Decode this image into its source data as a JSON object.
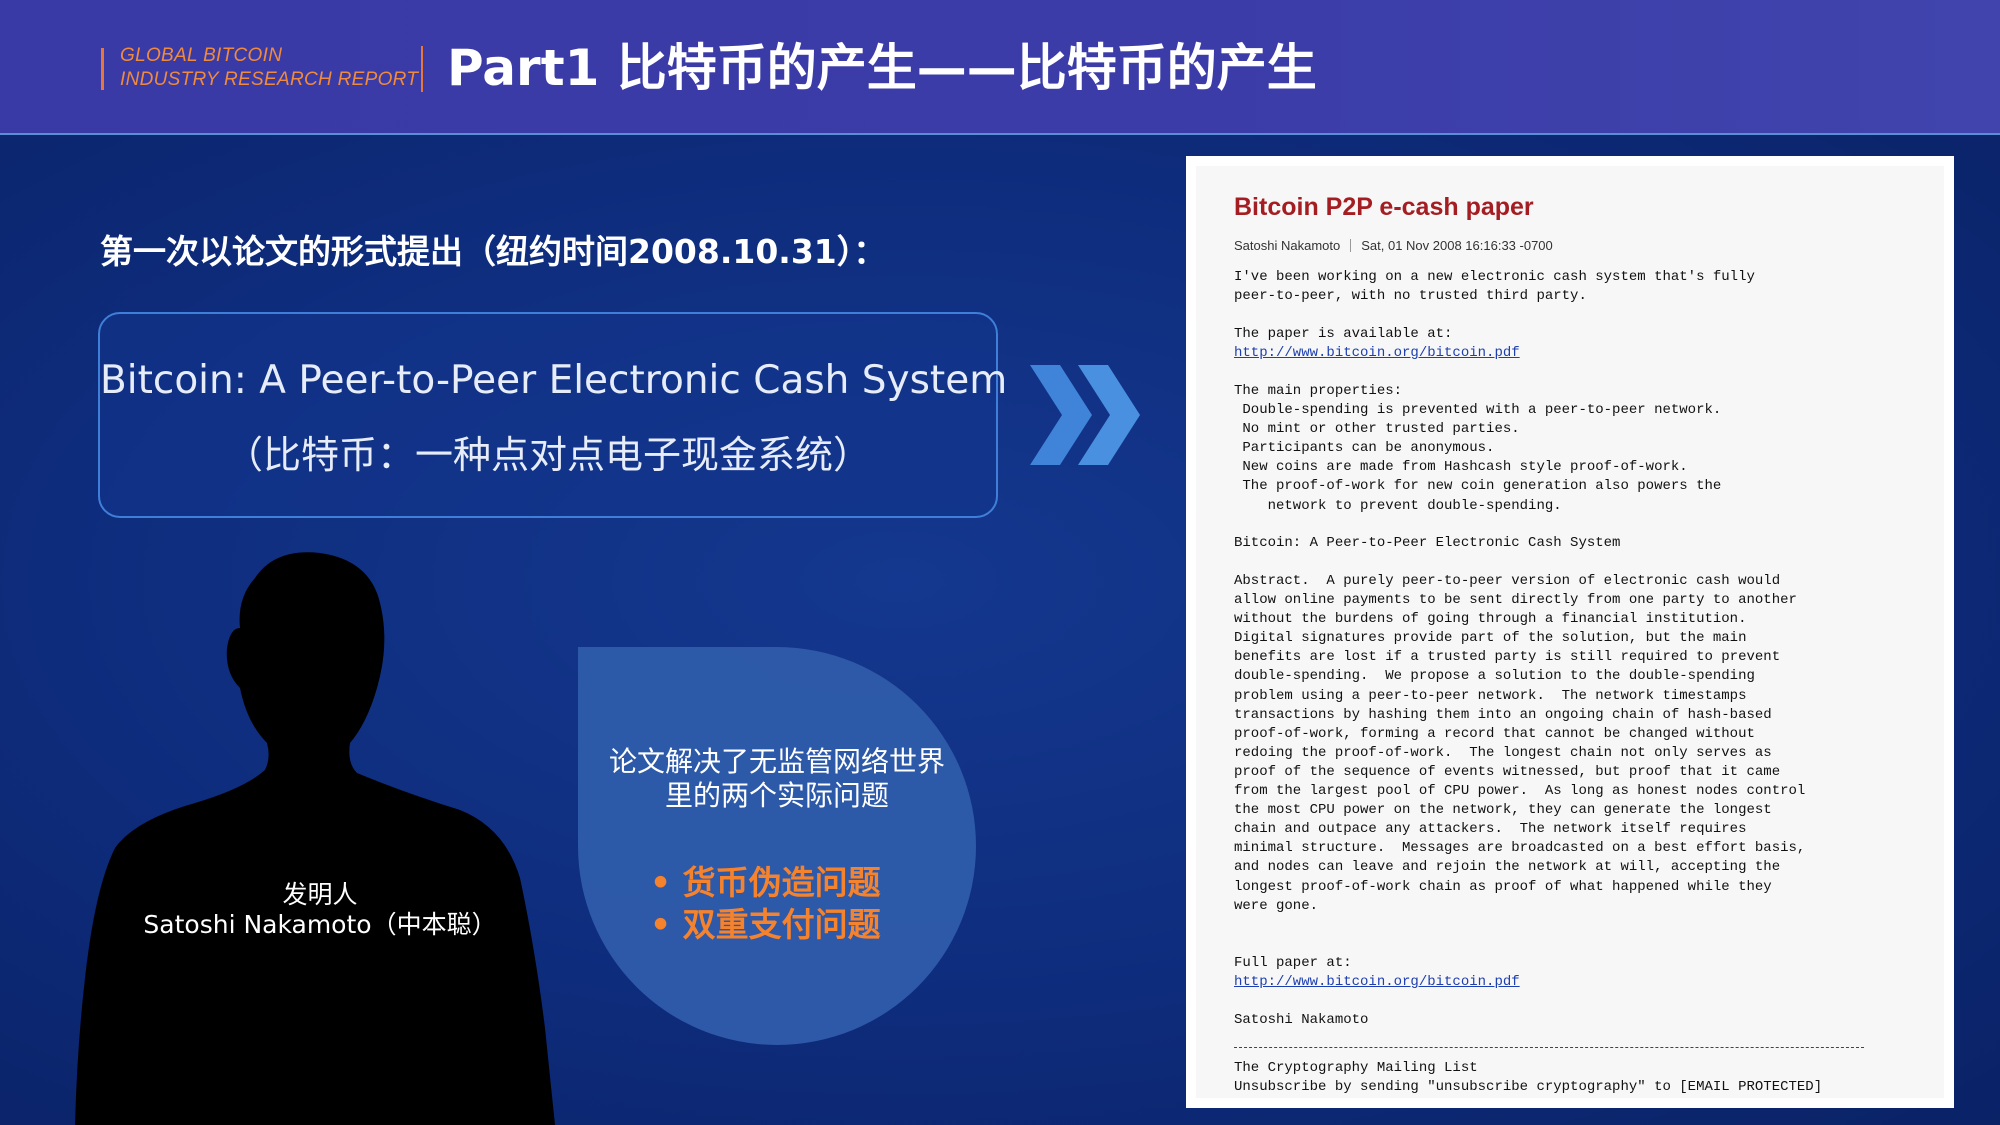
{
  "header": {
    "brand_line1": "GLOBAL BITCOIN",
    "brand_line2": "INDUSTRY RESEARCH REPORT",
    "title": "Part1 比特币的产生——比特币的产生"
  },
  "intro": {
    "subtitle": "第一次以论文的形式提出（纽约时间2008.10.31）：",
    "paper_title_en": "Bitcoin: A Peer-to-Peer Electronic Cash System",
    "paper_title_cn": "（比特币：一种点对点电子现金系统）"
  },
  "inventor": {
    "role": "发明人",
    "name": "Satoshi Nakamoto（中本聪）"
  },
  "bubble": {
    "text_line1": "论文解决了无监管网络世界",
    "text_line2": "里的两个实际问题",
    "items": [
      "货币伪造问题",
      "双重支付问题"
    ]
  },
  "document": {
    "title": "Bitcoin P2P e-cash paper",
    "author": "Satoshi Nakamoto",
    "date": "Sat, 01 Nov 2008 16:16:33 -0700",
    "intro": "I've been working on a new electronic cash system that's fully\npeer-to-peer, with no trusted third party.",
    "available_label": "The paper is available at:",
    "link": "http://www.bitcoin.org/bitcoin.pdf",
    "properties": "The main properties:\n Double-spending is prevented with a peer-to-peer network.\n No mint or other trusted parties.\n Participants can be anonymous.\n New coins are made from Hashcash style proof-of-work.\n The proof-of-work for new coin generation also powers the\n    network to prevent double-spending.",
    "paper_name": "Bitcoin: A Peer-to-Peer Electronic Cash System",
    "abstract": "Abstract.  A purely peer-to-peer version of electronic cash would\nallow online payments to be sent directly from one party to another\nwithout the burdens of going through a financial institution.\nDigital signatures provide part of the solution, but the main\nbenefits are lost if a trusted party is still required to prevent\ndouble-spending.  We propose a solution to the double-spending\nproblem using a peer-to-peer network.  The network timestamps\ntransactions by hashing them into an ongoing chain of hash-based\nproof-of-work, forming a record that cannot be changed without\nredoing the proof-of-work.  The longest chain not only serves as\nproof of the sequence of events witnessed, but proof that it came\nfrom the largest pool of CPU power.  As long as honest nodes control\nthe most CPU power on the network, they can generate the longest\nchain and outpace any attackers.  The network itself requires\nminimal structure.  Messages are broadcasted on a best effort basis,\nand nodes can leave and rejoin the network at will, accepting the\nlongest proof-of-work chain as proof of what happened while they\nwere gone.",
    "full_paper_label": "Full paper at:",
    "full_paper_link": "http://www.bitcoin.org/bitcoin.pdf",
    "signature": "Satoshi Nakamoto",
    "footer": "The Cryptography Mailing List\nUnsubscribe by sending \"unsubscribe cryptography\" to [EMAIL PROTECTED]"
  },
  "colors": {
    "background": "#0d2a78",
    "header": "#3a3aa6",
    "accent_orange": "#f5822d",
    "doc_title_red": "#a41d22",
    "link_blue": "#1d3fb0"
  }
}
